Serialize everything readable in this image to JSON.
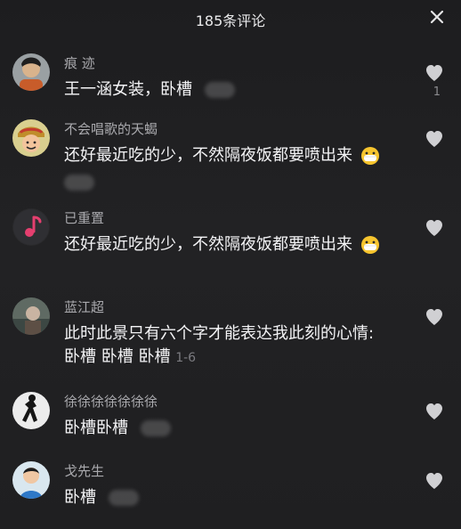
{
  "header": {
    "title": "185条评论",
    "close_icon": "close-icon"
  },
  "comments": [
    {
      "username": "痕  迹",
      "text": "王一涵女装，卧槽",
      "like_count": "1"
    },
    {
      "username": "不会唱歌的天蝎",
      "text": "还好最近吃的少，不然隔夜饭都要喷出来"
    },
    {
      "username": "已重置",
      "text": "还好最近吃的少，不然隔夜饭都要喷出来"
    },
    {
      "username": "蓝江超",
      "text_line1": "此时此景只有六个字才能表达我此刻的心情:",
      "text_line2": "卧槽 卧槽 卧槽",
      "meta": "1-6"
    },
    {
      "username": "徐徐徐徐徐徐徐",
      "text": "卧槽卧槽"
    },
    {
      "username": "戈先生",
      "text": "卧槽"
    }
  ],
  "colors": {
    "background": "#1f1f21",
    "username": "#a9a9ad",
    "text": "#f4f4f6",
    "muted": "#7b7b80",
    "like_icon": "#d0d0d3"
  }
}
